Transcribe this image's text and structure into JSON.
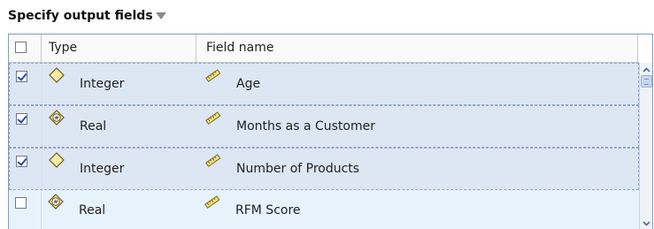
{
  "section": {
    "title": "Specify output fields"
  },
  "table": {
    "columns": {
      "type": "Type",
      "field_name": "Field name"
    },
    "rows": [
      {
        "checked": true,
        "type": "Integer",
        "type_icon": "integer-diamond-icon",
        "field_name": "Age",
        "field_icon": "ruler-icon",
        "state": "selected"
      },
      {
        "checked": true,
        "type": "Real",
        "type_icon": "real-hash-icon",
        "field_name": "Months as a Customer",
        "field_icon": "ruler-icon",
        "state": "selected"
      },
      {
        "checked": true,
        "type": "Integer",
        "type_icon": "integer-diamond-icon",
        "field_name": "Number of Products",
        "field_icon": "ruler-icon",
        "state": "selected"
      },
      {
        "checked": false,
        "type": "Real",
        "type_icon": "real-hash-icon",
        "field_name": "RFM Score",
        "field_icon": "ruler-icon",
        "state": "unselected"
      }
    ]
  },
  "colors": {
    "selected_row": "#dde6f3",
    "unselected_row": "#e6f3fa",
    "grid_border": "#7f9db9"
  }
}
